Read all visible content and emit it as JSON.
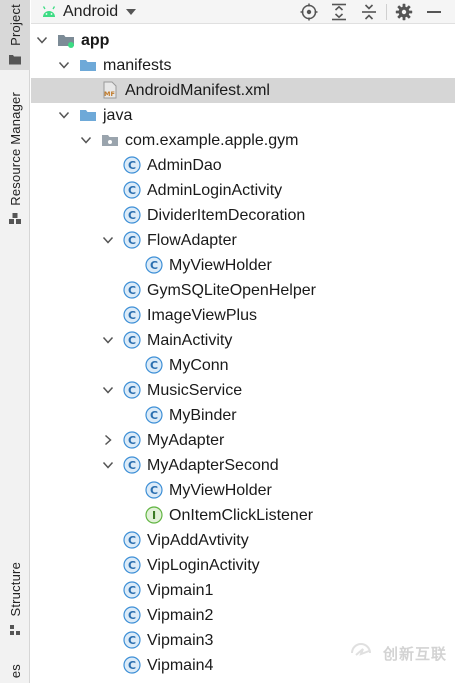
{
  "side_strip": {
    "tabs": [
      {
        "label": "Project",
        "active": true
      },
      {
        "label": "Resource Manager",
        "active": false
      },
      {
        "label": "Structure",
        "active": false
      },
      {
        "label": "es",
        "active": false
      }
    ]
  },
  "toolbar": {
    "view_selector": "Android",
    "buttons": [
      "locate-icon",
      "expand-all-icon",
      "collapse-all-icon",
      "gear-icon",
      "minimize-icon"
    ]
  },
  "tree": {
    "rows": [
      {
        "label": "app",
        "depth": 0,
        "chevron": "down",
        "icon": "module",
        "bold": true
      },
      {
        "label": "manifests",
        "depth": 1,
        "chevron": "down",
        "icon": "folder"
      },
      {
        "label": "AndroidManifest.xml",
        "depth": 2,
        "chevron": "none",
        "icon": "manifest",
        "selected": true
      },
      {
        "label": "java",
        "depth": 1,
        "chevron": "down",
        "icon": "folder"
      },
      {
        "label": "com.example.apple.gym",
        "depth": 2,
        "chevron": "down",
        "icon": "package"
      },
      {
        "label": "AdminDao",
        "depth": 3,
        "chevron": "none",
        "icon": "class"
      },
      {
        "label": "AdminLoginActivity",
        "depth": 3,
        "chevron": "none",
        "icon": "class"
      },
      {
        "label": "DividerItemDecoration",
        "depth": 3,
        "chevron": "none",
        "icon": "class"
      },
      {
        "label": "FlowAdapter",
        "depth": 3,
        "chevron": "down",
        "icon": "class"
      },
      {
        "label": "MyViewHolder",
        "depth": 4,
        "chevron": "none",
        "icon": "class"
      },
      {
        "label": "GymSQLiteOpenHelper",
        "depth": 3,
        "chevron": "none",
        "icon": "class"
      },
      {
        "label": "ImageViewPlus",
        "depth": 3,
        "chevron": "none",
        "icon": "class"
      },
      {
        "label": "MainActivity",
        "depth": 3,
        "chevron": "down",
        "icon": "class"
      },
      {
        "label": "MyConn",
        "depth": 4,
        "chevron": "none",
        "icon": "class"
      },
      {
        "label": "MusicService",
        "depth": 3,
        "chevron": "down",
        "icon": "class"
      },
      {
        "label": "MyBinder",
        "depth": 4,
        "chevron": "none",
        "icon": "class"
      },
      {
        "label": "MyAdapter",
        "depth": 3,
        "chevron": "right",
        "icon": "class"
      },
      {
        "label": "MyAdapterSecond",
        "depth": 3,
        "chevron": "down",
        "icon": "class"
      },
      {
        "label": "MyViewHolder",
        "depth": 4,
        "chevron": "none",
        "icon": "class"
      },
      {
        "label": "OnItemClickListener",
        "depth": 4,
        "chevron": "none",
        "icon": "interface"
      },
      {
        "label": "VipAddAvtivity",
        "depth": 3,
        "chevron": "none",
        "icon": "class"
      },
      {
        "label": "VipLoginActivity",
        "depth": 3,
        "chevron": "none",
        "icon": "class"
      },
      {
        "label": "Vipmain1",
        "depth": 3,
        "chevron": "none",
        "icon": "class"
      },
      {
        "label": "Vipmain2",
        "depth": 3,
        "chevron": "none",
        "icon": "class"
      },
      {
        "label": "Vipmain3",
        "depth": 3,
        "chevron": "none",
        "icon": "class"
      },
      {
        "label": "Vipmain4",
        "depth": 3,
        "chevron": "none",
        "icon": "class"
      }
    ]
  },
  "icon_glyphs": {
    "class": "C",
    "interface": "I",
    "manifest": "MF"
  },
  "colors": {
    "class_icon": "#3d8fd6",
    "interface_icon": "#62b543",
    "folder": "#6ea9d8",
    "android_green": "#3ddc84"
  },
  "watermark": {
    "text": "创新互联"
  }
}
